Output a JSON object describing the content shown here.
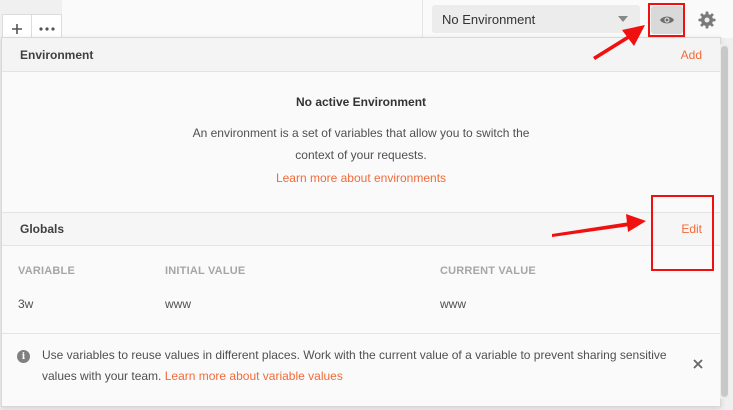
{
  "tab_controls": [
    {
      "name": "new-tab-button",
      "icon": "plus-icon"
    },
    {
      "name": "more-tabs-button",
      "icon": "ellipsis-icon"
    }
  ],
  "environment_selector": {
    "value": "No Environment",
    "icon": "chevron-down-icon"
  },
  "toolbar": {
    "quick_look_icon": "eye-icon",
    "settings_icon": "gear-icon"
  },
  "environment_section": {
    "title": "Environment",
    "action": "Add",
    "empty_title": "No active Environment",
    "empty_description": "An environment is a set of variables that allow you to switch the context of your requests.",
    "learn_more": "Learn more about environments"
  },
  "globals_section": {
    "title": "Globals",
    "action": "Edit",
    "columns": [
      "VARIABLE",
      "INITIAL VALUE",
      "CURRENT VALUE"
    ],
    "rows": [
      {
        "variable": "3w",
        "initial": "www",
        "current": "www"
      }
    ]
  },
  "info_banner": {
    "text": "Use variables to reuse values in different places. Work with the current value of a variable to prevent sharing sensitive values with your team.",
    "link": "Learn more about variable values",
    "icon": "info-icon",
    "close_icon": "close-icon"
  },
  "colors": {
    "accent": "#f26b3a",
    "annotation": "#f01010"
  }
}
